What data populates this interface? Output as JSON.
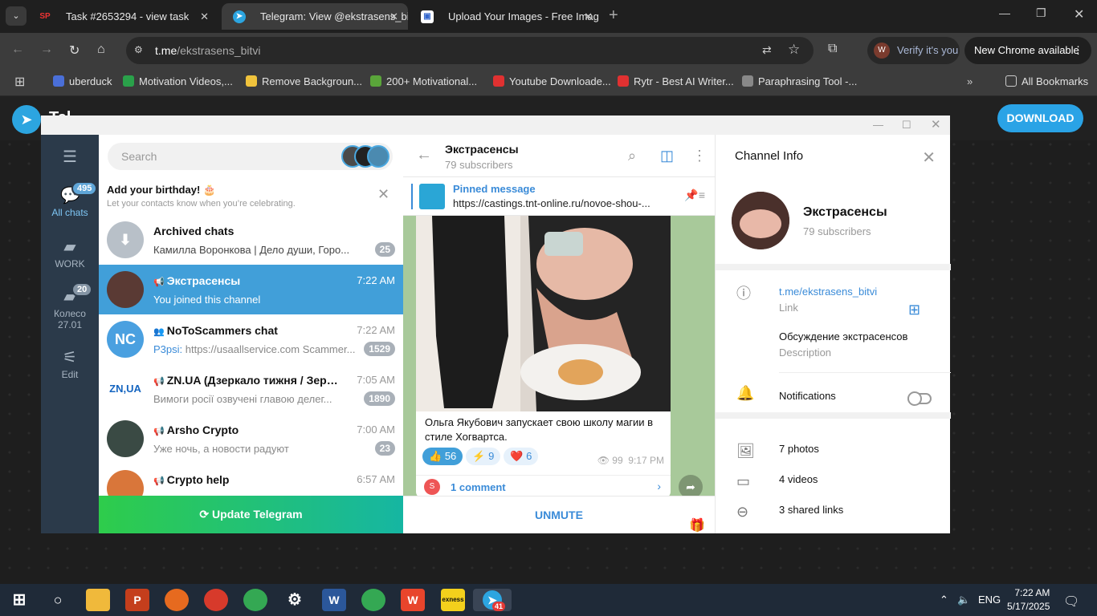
{
  "browser": {
    "tabs": [
      {
        "title": "Task #2653294 - view task",
        "favicon": "SP"
      },
      {
        "title": "Telegram: View @ekstrasens_bi",
        "favicon": "tg"
      },
      {
        "title": "Upload Your Images - Free Imag",
        "favicon": "img"
      }
    ],
    "url_host": "t.me",
    "url_path": "/ekstrasens_bitvi",
    "verify": "Verify it's you",
    "verify_initial": "W",
    "new_chrome": "New Chrome available",
    "bookmarks": [
      {
        "label": "uberduck",
        "color": "#4a6fd8"
      },
      {
        "label": "Motivation Videos,...",
        "color": "#2aa14a"
      },
      {
        "label": "Remove Backgroun...",
        "color": "#f0c33c"
      },
      {
        "label": "200+ Motivational...",
        "color": "#5aa53a"
      },
      {
        "label": "Youtube Downloade...",
        "color": "#e03131"
      },
      {
        "label": "Rytr - Best AI Writer...",
        "color": "#e03131"
      },
      {
        "label": "Paraphrasing Tool -...",
        "color": "#888888"
      }
    ],
    "all_bookmarks": "All Bookmarks"
  },
  "tgweb": {
    "brand_partial": "Tel",
    "download": "DOWNLOAD"
  },
  "leftbar": {
    "all_chats": "All chats",
    "all_badge": "495",
    "work": "WORK",
    "kolo": "Колесо 27.01",
    "kolo_badge": "20",
    "edit": "Edit"
  },
  "chatlist": {
    "search_placeholder": "Search",
    "bday_title": "Add your birthday! 🎂",
    "bday_sub": "Let your contacts know when you’re celebrating.",
    "chats": [
      {
        "name": "Archived chats",
        "time": "",
        "prefix": "",
        "msg": "Камилла Воронкова | Дело души, Горо...",
        "count": "25",
        "avatar": "archive",
        "color": "#b8c0c8"
      },
      {
        "name": "Экстрасенсы",
        "time": "7:22 AM",
        "prefix": "",
        "msg": "You joined this channel",
        "count": "",
        "avatar": "",
        "color": "#5a3a34"
      },
      {
        "name": "NoToScammers chat",
        "time": "7:22 AM",
        "prefix": "P3psi: ",
        "msg": "https://usaallservice.com  Scammer...",
        "count": "1529",
        "avatar": "NC",
        "color": "#4aa0e0"
      },
      {
        "name": "ZN.UA (Дзеркало тижня / Зеркало...",
        "time": "7:05 AM",
        "prefix": "",
        "msg": "Вимоги росії озвучені главою делег...",
        "count": "1890",
        "avatar": "ZN,UA",
        "color": "#ffffff"
      },
      {
        "name": "Arsho Crypto",
        "time": "7:00 AM",
        "prefix": "",
        "msg": "Уже ночь, а новости радуют",
        "count": "23",
        "avatar": "",
        "color": "#3a4a44"
      },
      {
        "name": "Crypto help",
        "time": "6:57 AM",
        "prefix": "",
        "msg": "",
        "count": "",
        "avatar": "",
        "color": "#d9763a"
      }
    ],
    "update": "Update Telegram"
  },
  "chat": {
    "title": "Экстрасенсы",
    "subscribers": "79 subscribers",
    "pinned_label": "Pinned message",
    "pinned_text": "https://castings.tnt-online.ru/novoe-shou-...",
    "caption": "Ольга Якубович запускает свою школу магии в стиле Хогвартса.",
    "reactions": [
      {
        "emoji": "👍",
        "count": "56"
      },
      {
        "emoji": "⚡",
        "count": "9"
      },
      {
        "emoji": "❤️",
        "count": "6"
      }
    ],
    "views": "99",
    "time": "9:17 PM",
    "comments": "1 comment",
    "comment_avatar": "S",
    "unmute": "UNMUTE"
  },
  "info": {
    "header": "Channel Info",
    "name": "Экстрасенсы",
    "subscribers": "79 subscribers",
    "link": "t.me/ekstrasens_bitvi",
    "link_label": "Link",
    "description": "Обсуждение экстрасенсов",
    "description_label": "Description",
    "notifications": "Notifications",
    "photos": "7 photos",
    "videos": "4 videos",
    "links": "3 shared links"
  },
  "taskbar": {
    "lang": "ENG",
    "time": "7:22 AM",
    "date": "5/17/2025",
    "tg_badge": "41"
  }
}
